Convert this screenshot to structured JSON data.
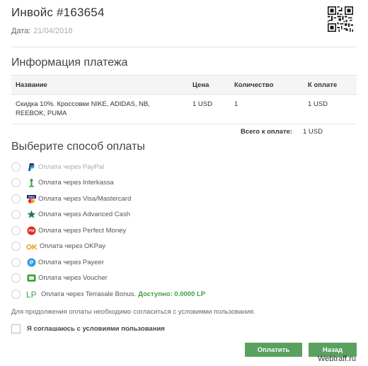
{
  "invoice": {
    "title": "Инвойс #163654",
    "date_label": "Дата:",
    "date_value": "21/04/2018"
  },
  "payment_info": {
    "title": "Информация платежа",
    "columns": [
      "Название",
      "Цена",
      "Количество",
      "К оплате"
    ],
    "rows": [
      {
        "name_line1": "Скидка 10%. Кроссовки NIKE, ADIDAS, NB,",
        "name_line2": "REEBOK, PUMA",
        "price": "1 USD",
        "quantity": "1",
        "to_pay": "1 USD"
      }
    ],
    "total_label": "Всего к оплате:",
    "total_value": "1 USD"
  },
  "payment_methods": {
    "title": "Выберите способ оплаты",
    "items": [
      {
        "label": "Оплата через PayPal",
        "icon": "paypal-icon"
      },
      {
        "label": "Оплата через Interkassa",
        "icon": "interkassa-icon"
      },
      {
        "label": "Оплата через Visa/Mastercard",
        "icon": "visa-mastercard-icon"
      },
      {
        "label": "Оплата через Advanced Cash",
        "icon": "advanced-cash-icon"
      },
      {
        "label": "Оплата через Perfect Money",
        "icon": "perfect-money-icon"
      },
      {
        "label": "Оплата через OKPay",
        "icon": "okpay-icon"
      },
      {
        "label": "Оплата через Payeer",
        "icon": "payeer-icon"
      },
      {
        "label": "Оплата через Voucher",
        "icon": "voucher-icon"
      },
      {
        "label": "Оплата через Terrasale Bonus.",
        "icon": "terrasale-lp-icon",
        "available": "Доступно: 0.0000 LP"
      }
    ]
  },
  "agreement": {
    "notice": "Для продолжения оплаты необходимо согласиться с условиями пользования.",
    "checkbox_label": "Я соглашаюсь с условиями пользования"
  },
  "buttons": {
    "pay": "Оплатить",
    "back": "Назад"
  },
  "watermark": "Webtraff.ru",
  "colors": {
    "accent_green": "#5aa15f",
    "available_green": "#3c9e48"
  }
}
